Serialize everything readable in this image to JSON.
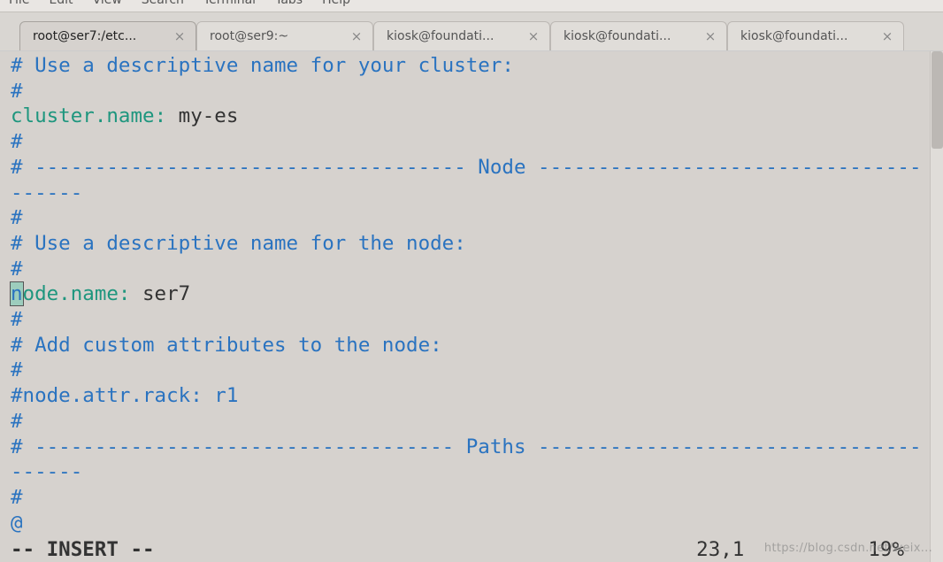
{
  "menu": {
    "file": "File",
    "edit": "Edit",
    "view": "View",
    "search": "Search",
    "terminal": "Terminal",
    "tabs": "Tabs",
    "help": "Help"
  },
  "tabs": [
    {
      "label": "root@ser7:/etc...",
      "active": true
    },
    {
      "label": "root@ser9:~",
      "active": false
    },
    {
      "label": "kiosk@foundati...",
      "active": false
    },
    {
      "label": "kiosk@foundati...",
      "active": false
    },
    {
      "label": "kiosk@foundati...",
      "active": false
    }
  ],
  "editor": {
    "lines": [
      {
        "type": "comment",
        "text": "# Use a descriptive name for your cluster:"
      },
      {
        "type": "comment",
        "text": "#"
      },
      {
        "type": "kv",
        "key": "cluster.name",
        "value": "my-es"
      },
      {
        "type": "comment",
        "text": "#"
      },
      {
        "type": "section",
        "prefix": "# ------------------------------------ ",
        "title": "Node",
        "suffix": " --------------------------------------"
      },
      {
        "type": "comment",
        "text": "#"
      },
      {
        "type": "comment",
        "text": "# Use a descriptive name for the node:"
      },
      {
        "type": "comment",
        "text": "#"
      },
      {
        "type": "kv_cursor",
        "cursor_char": "n",
        "rest_key": "ode.name",
        "value": "ser7"
      },
      {
        "type": "comment",
        "text": "#"
      },
      {
        "type": "comment",
        "text": "# Add custom attributes to the node:"
      },
      {
        "type": "comment",
        "text": "#"
      },
      {
        "type": "comment",
        "text": "#node.attr.rack: r1"
      },
      {
        "type": "comment",
        "text": "#"
      },
      {
        "type": "section",
        "prefix": "# ----------------------------------- ",
        "title": "Paths",
        "suffix": " --------------------------------------"
      },
      {
        "type": "comment",
        "text": "#"
      },
      {
        "type": "at",
        "text": "@"
      }
    ]
  },
  "status": {
    "mode": "-- INSERT --",
    "position": "23,1",
    "percent": "19%"
  },
  "watermark": "https://blog.csdn.net/weix..."
}
